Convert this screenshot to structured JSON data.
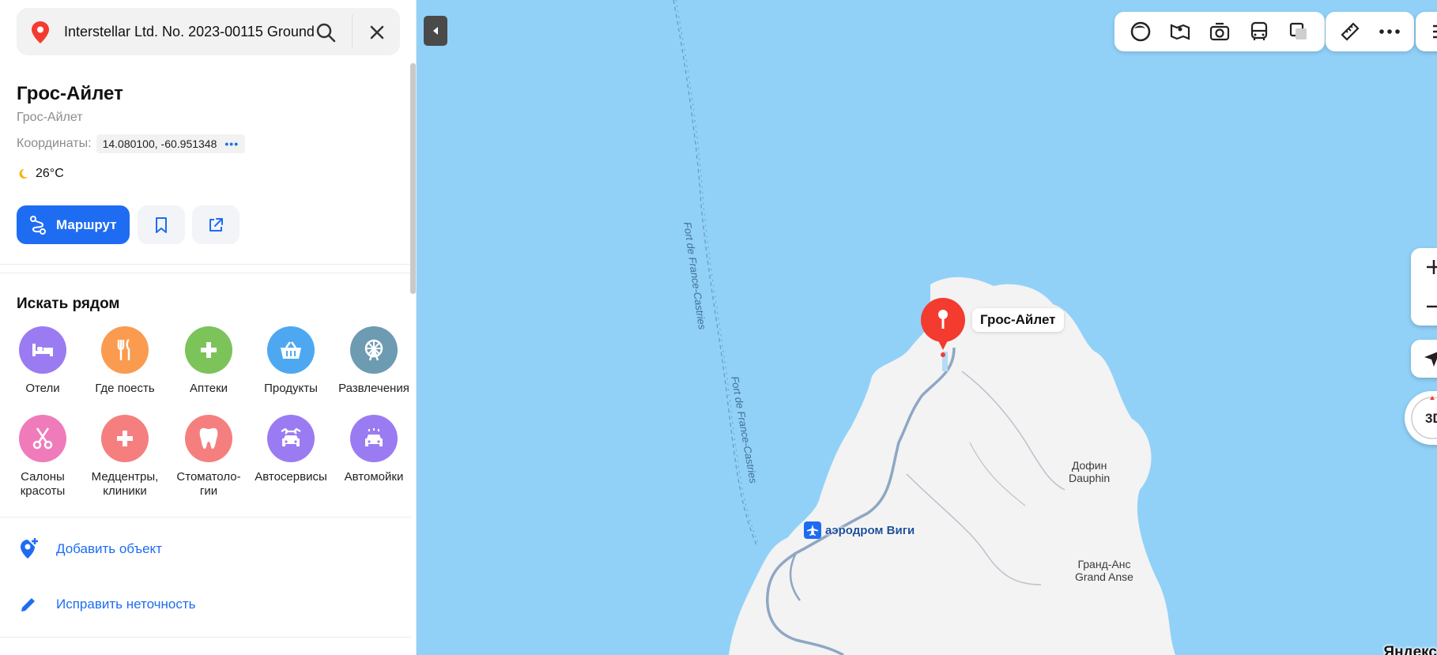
{
  "search": {
    "query": "Interstellar Ltd. No. 2023-00115 Ground"
  },
  "place": {
    "title": "Грос-Айлет",
    "subtitle": "Грос-Айлет",
    "coords_label": "Координаты:",
    "coords_value": "14.080100, -60.951348",
    "weather": "26°C"
  },
  "actions": {
    "route_label": "Маршрут"
  },
  "nearby": {
    "title": "Искать рядом",
    "categories": [
      {
        "label": "Отели",
        "color": "#9b7bf2",
        "icon": "bed-icon"
      },
      {
        "label": "Где поесть",
        "color": "#fb9b4f",
        "icon": "fork-knife-icon"
      },
      {
        "label": "Аптеки",
        "color": "#7cc35a",
        "icon": "plus-icon"
      },
      {
        "label": "Продукты",
        "color": "#4ea8f1",
        "icon": "basket-icon"
      },
      {
        "label": "Развлечения",
        "color": "#6d9bb1",
        "icon": "ferris-wheel-icon"
      },
      {
        "label": "Салоны\nкрасоты",
        "color": "#f07bbb",
        "icon": "scissors-icon"
      },
      {
        "label": "Медцентры,\nклиники",
        "color": "#f57f7f",
        "icon": "cross-icon"
      },
      {
        "label": "Стоматоло-\nгии",
        "color": "#f57f7f",
        "icon": "tooth-icon"
      },
      {
        "label": "Автосервисы",
        "color": "#9b7bf2",
        "icon": "car-service-icon"
      },
      {
        "label": "Автомойки",
        "color": "#9b7bf2",
        "icon": "car-wash-icon"
      }
    ]
  },
  "links": {
    "add_object": "Добавить объект",
    "fix_error": "Исправить неточность"
  },
  "map": {
    "pin_label": "Грос-Айлет",
    "airport": "аэродром Виги",
    "route_1": "Fort de France-Castries",
    "route_2": "Fort de France-Castries",
    "place_dauphin_ru": "Дофин",
    "place_dauphin_en": "Dauphin",
    "place_grandanse_ru": "Гранд-Анс",
    "place_grandanse_en": "Grand Anse",
    "mode_3d": "3D",
    "brand": "Яндекс",
    "colors": {
      "water": "#91d1f8",
      "land": "#f3f3f3",
      "accent": "#1e6cf2",
      "pin": "#f43b2f"
    }
  }
}
